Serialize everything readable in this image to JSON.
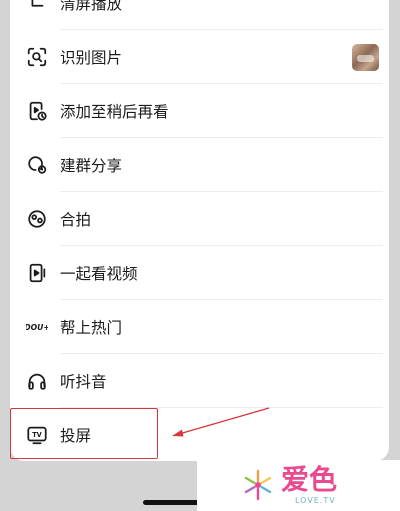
{
  "menu": {
    "items": [
      {
        "label": "清屏播放",
        "icon": "clear-screen-icon"
      },
      {
        "label": "识别图片",
        "icon": "scan-image-icon",
        "has_thumbnail": true
      },
      {
        "label": "添加至稍后再看",
        "icon": "watch-later-icon"
      },
      {
        "label": "建群分享",
        "icon": "group-share-icon"
      },
      {
        "label": "合拍",
        "icon": "duet-icon"
      },
      {
        "label": "一起看视频",
        "icon": "watch-together-icon"
      },
      {
        "label": "帮上热门",
        "icon": "dou-plus-icon",
        "icon_text": "DOU+"
      },
      {
        "label": "听抖音",
        "icon": "headphones-icon"
      },
      {
        "label": "投屏",
        "icon": "tv-cast-icon",
        "icon_text": "TV",
        "highlighted": true
      }
    ]
  },
  "annotation": {
    "color": "#d9363e"
  },
  "watermark": {
    "brand": "爱色",
    "sub": "LOVE.TV",
    "brand_color": "#e94a8f",
    "sub_color": "#6cb2c7"
  }
}
